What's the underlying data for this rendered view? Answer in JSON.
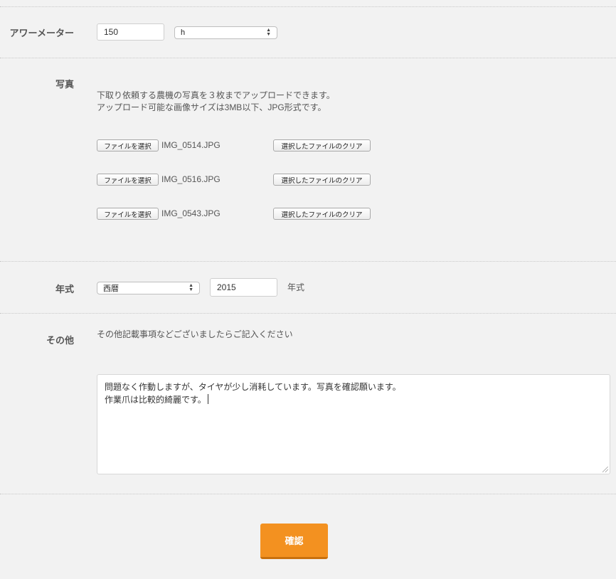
{
  "hour_meter": {
    "label": "アワーメーター",
    "value": "150",
    "unit_selected": "h"
  },
  "photos": {
    "label": "写真",
    "description_line1": "下取り依頼する農機の写真を３枚までアップロードできます。",
    "description_line2": "アップロード可能な画像サイズは3MB以下、JPG形式です。",
    "choose_label": "ファイルを選択",
    "clear_label": "選択したファイルのクリア",
    "files": [
      "IMG_0514.JPG",
      "IMG_0516.JPG",
      "IMG_0543.JPG"
    ]
  },
  "year": {
    "label": "年式",
    "era_selected": "西暦",
    "value": "2015",
    "suffix": "年式"
  },
  "other": {
    "label": "その他",
    "hint": "その他記載事項などございましたらご記入ください",
    "text_line1": "問題なく作動しますが、タイヤが少し消耗しています。写真を確認願います。",
    "text_line2": "作業爪は比較的綺麗です。"
  },
  "submit_label": "確認"
}
